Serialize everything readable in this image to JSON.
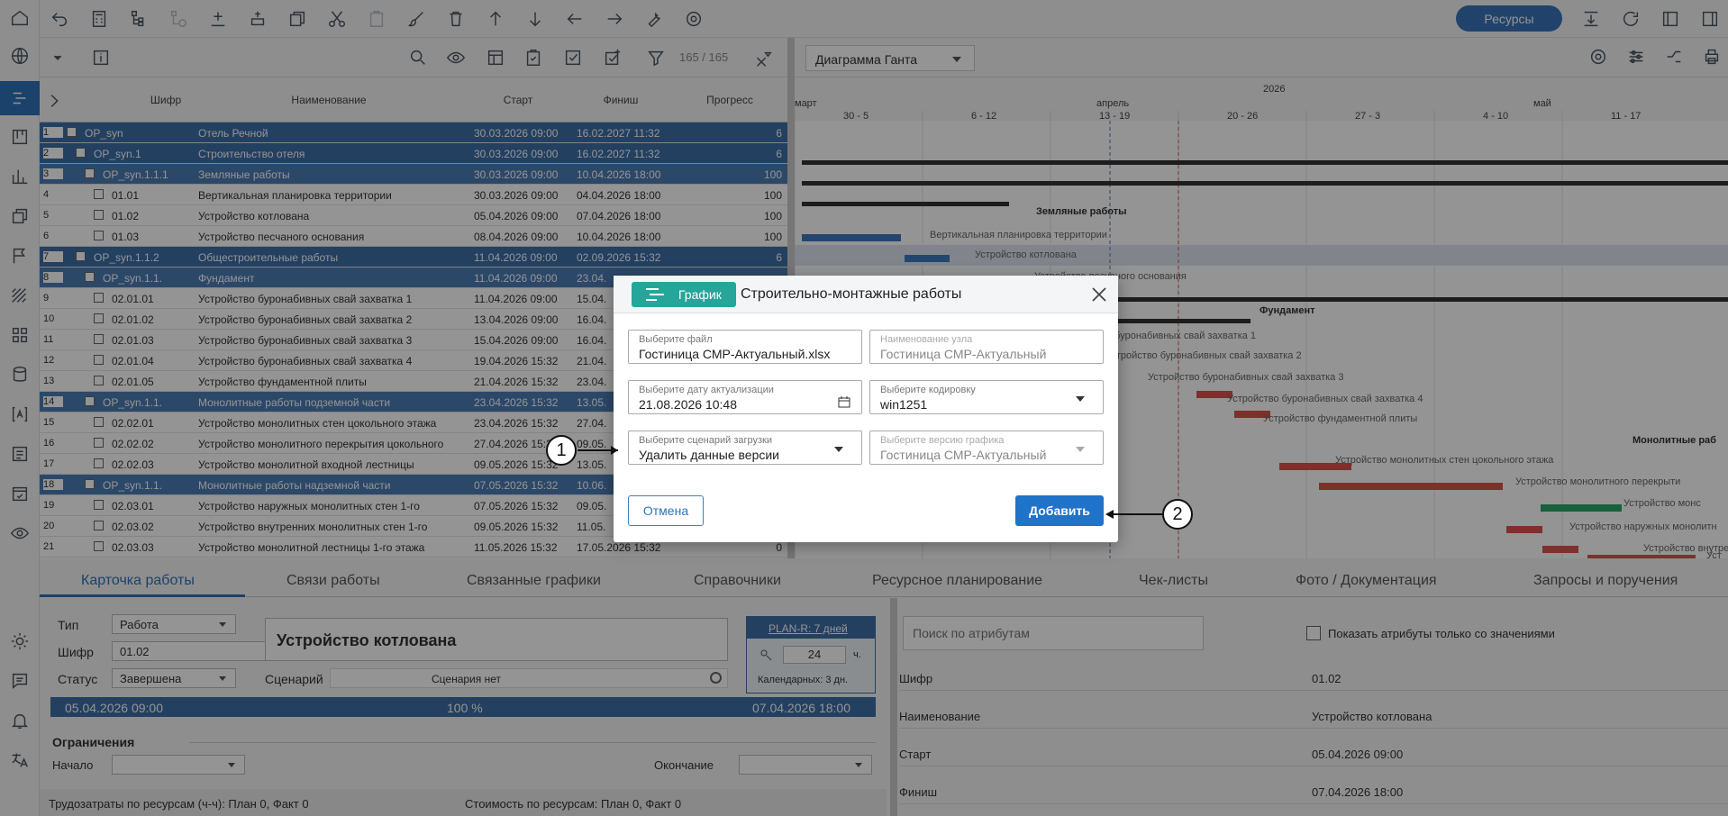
{
  "toolbar": {
    "resources_label": "Ресурсы"
  },
  "filter": {
    "counter": "165 / 165"
  },
  "table": {
    "headers": [
      "Шифр",
      "Наименование",
      "Старт",
      "Финиш",
      "Прогресс"
    ],
    "rows": [
      {
        "n": "1",
        "code": "OP_syn",
        "name": "Отель Речной",
        "start": "30.03.2026 09:00",
        "finish": "16.02.2027 11:32",
        "prog": "6"
      },
      {
        "n": "2",
        "code": "OP_syn.1",
        "name": "Строительство отеля",
        "start": "30.03.2026 09:00",
        "finish": "16.02.2027 11:32",
        "prog": "6"
      },
      {
        "n": "3",
        "code": "OP_syn.1.1.1",
        "name": "Земляные работы",
        "start": "30.03.2026 09:00",
        "finish": "10.04.2026 18:00",
        "prog": "100"
      },
      {
        "n": "4",
        "code": "01.01",
        "name": "Вертикальная планировка территории",
        "start": "30.03.2026 09:00",
        "finish": "04.04.2026 18:00",
        "prog": "100"
      },
      {
        "n": "5",
        "code": "01.02",
        "name": "Устройство котлована",
        "start": "05.04.2026 09:00",
        "finish": "07.04.2026 18:00",
        "prog": "100"
      },
      {
        "n": "6",
        "code": "01.03",
        "name": "Устройство песчаного основания",
        "start": "08.04.2026 09:00",
        "finish": "10.04.2026 18:00",
        "prog": "100"
      },
      {
        "n": "7",
        "code": "OP_syn.1.1.2",
        "name": "Общестроительные работы",
        "start": "11.04.2026 09:00",
        "finish": "02.09.2026 15:32",
        "prog": "6"
      },
      {
        "n": "8",
        "code": "OP_syn.1.1.",
        "name": "Фундамент",
        "start": "11.04.2026 09:00",
        "finish": "23.04.",
        "prog": ""
      },
      {
        "n": "9",
        "code": "02.01.01",
        "name": "Устройство буронабивных свай захватка 1",
        "start": "11.04.2026 09:00",
        "finish": "15.04.",
        "prog": ""
      },
      {
        "n": "10",
        "code": "02.01.02",
        "name": "Устройство буронабивных свай захватка 2",
        "start": "13.04.2026 09:00",
        "finish": "16.04.",
        "prog": ""
      },
      {
        "n": "11",
        "code": "02.01.03",
        "name": "Устройство буронабивных свай захватка 3",
        "start": "15.04.2026 09:00",
        "finish": "16.04.",
        "prog": ""
      },
      {
        "n": "12",
        "code": "02.01.04",
        "name": "Устройство буронабивных свай захватка 4",
        "start": "19.04.2026 15:32",
        "finish": "21.04.",
        "prog": ""
      },
      {
        "n": "13",
        "code": "02.01.05",
        "name": "Устройство фундаментной плиты",
        "start": "21.04.2026 15:32",
        "finish": "23.04.",
        "prog": ""
      },
      {
        "n": "14",
        "code": "OP_syn.1.1.",
        "name": "Монолитные работы подземной части",
        "start": "23.04.2026 15:32",
        "finish": "13.05.",
        "prog": ""
      },
      {
        "n": "15",
        "code": "02.02.01",
        "name": "Устройство монолитных стен цокольного этажа",
        "start": "23.04.2026 15:32",
        "finish": "27.04.",
        "prog": ""
      },
      {
        "n": "16",
        "code": "02.02.02",
        "name": "Устройство монолитного перекрытия цокольного",
        "start": "27.04.2026 15:32",
        "finish": "09.05.",
        "prog": ""
      },
      {
        "n": "17",
        "code": "02.02.03",
        "name": "Устройство монолитной входной лестницы",
        "start": "09.05.2026 15:32",
        "finish": "13.05.",
        "prog": ""
      },
      {
        "n": "18",
        "code": "OP_syn.1.1.",
        "name": "Монолитные работы надземной части",
        "start": "07.05.2026 15:32",
        "finish": "10.06.",
        "prog": ""
      },
      {
        "n": "19",
        "code": "02.03.01",
        "name": "Устройство наружных монолитных стен 1-го",
        "start": "07.05.2026 15:32",
        "finish": "09.05.",
        "prog": ""
      },
      {
        "n": "20",
        "code": "02.03.02",
        "name": "Устройство внутренних монолитных стен 1-го",
        "start": "09.05.2026 15:32",
        "finish": "11.05.",
        "prog": ""
      },
      {
        "n": "21",
        "code": "02.03.03",
        "name": "Устройство монолитной лестницы 1-го этажа",
        "start": "11.05.2026 15:32",
        "finish": "17.05.2026 15:32",
        "prog": "0"
      }
    ]
  },
  "gantt": {
    "view": "Диаграмма Ганта",
    "year": "2026",
    "months": [
      "март",
      "апрель",
      "май"
    ],
    "weeks": [
      "30 - 5",
      "6 - 12",
      "13 - 19",
      "20 - 26",
      "27 - 3",
      "4 - 10",
      "11 - 17"
    ],
    "labels": [
      "Земляные работы",
      "Вертикальная планировка территории",
      "Устройство котлована",
      "Устройство песчаного основания",
      "Фундамент",
      "о буронабивных свай захватка 1",
      "устройство буронабивных свай захватка 2",
      "Устройство буронабивных свай захватка 3",
      "Устройство буронабивных свай захватка 4",
      "Устройство фундаментной плиты",
      "Монолитные раб",
      "Устройство монолитных стен цокольного этажа",
      "Устройство монолитного перекрыти",
      "Устройство монс",
      "Устройство наружных монолитн",
      "Устройство внутрен",
      "Уст"
    ]
  },
  "bottom": {
    "tabs": [
      "Карточка работы",
      "Связи работы",
      "Связанные графики",
      "Справочники",
      "Ресурсное планирование",
      "Чек-листы",
      "Фото / Документация",
      "Запросы и поручения"
    ],
    "type_label": "Тип",
    "type_value": "Работа",
    "code_label": "Шифр",
    "code_value": "01.02",
    "status_label": "Статус",
    "status_value": "Завершена",
    "task_name": "Устройство котлована",
    "scenario_label": "Сценарий",
    "scenario_value": "Сценария нет",
    "plan_label": "PLAN-R: 7 дней",
    "hours_value": "24",
    "hours_unit": "ч.",
    "calendar_label": "Календарных: 3 дн.",
    "start_date": "05.04.2026 09:00",
    "progress": "100 %",
    "end_date": "07.04.2026 18:00",
    "constraints": "Ограничения",
    "start_label": "Начало",
    "end_label": "Окончание",
    "labor": "Трудозатраты по ресурсам (ч-ч): План 0, Факт 0",
    "cost": "Стоимость по ресурсам: План 0, Факт 0",
    "attr_search_placeholder": "Поиск по атрибутам",
    "attr_filter": "Показать атрибуты только со значениями",
    "attrs": [
      {
        "k": "Шифр",
        "v": "01.02"
      },
      {
        "k": "Наименование",
        "v": "Устройство котлована"
      },
      {
        "k": "Старт",
        "v": "05.04.2026 09:00"
      },
      {
        "k": "Финиш",
        "v": "07.04.2026 18:00"
      }
    ]
  },
  "modal": {
    "badge": "График",
    "title": "Строительно-монтажные работы",
    "file_label": "Выберите файл",
    "file_value": "Гостиница СМР-Актуальный.xlsx",
    "node_label": "Наименование узла",
    "node_value": "Гостиница СМР-Актуальный",
    "date_label": "Выберите дату актуализации",
    "date_value": "21.08.2026 10:48",
    "enc_label": "Выберите кодировку",
    "enc_value": "win1251",
    "scen_label": "Выберите сценарий загрузки",
    "scen_value": "Удалить данные версии",
    "ver_label": "Выберите версию графика",
    "ver_value": "Гостиница СМР-Актуальный",
    "cancel": "Отмена",
    "add": "Добавить"
  },
  "callouts": [
    "1",
    "2"
  ],
  "colors": {
    "accent": "#2f73b8",
    "primary_button": "#1f73c9",
    "badge": "#26a69a",
    "bar_red": "#d9534f",
    "bar_blue": "#3d79c2",
    "bar_green": "#2aa56b"
  }
}
